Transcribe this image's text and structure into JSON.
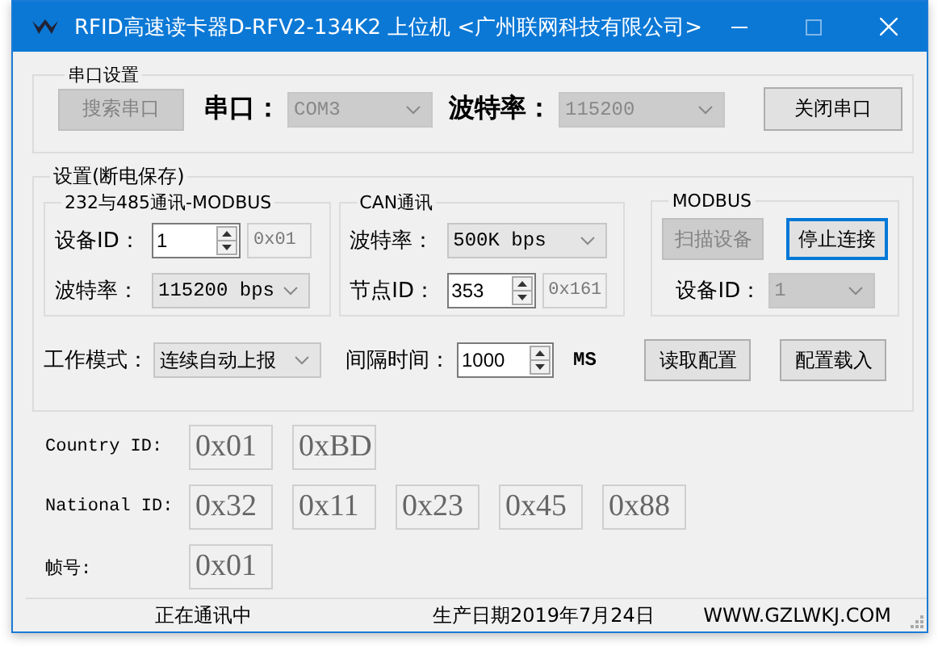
{
  "window": {
    "title": "RFID高速读卡器D-RFV2-134K2 上位机 <广州联网科技有限公司>"
  },
  "serial_settings": {
    "title": "串口设置",
    "search_button": {
      "label": "搜索串口",
      "disabled": true
    },
    "port_label": "串口：",
    "port": {
      "value": "COM3",
      "disabled": true
    },
    "baud_label": "波特率：",
    "baud": {
      "value": "115200",
      "disabled": true
    },
    "close_button": {
      "label": "关闭串口",
      "disabled": false
    }
  },
  "settings": {
    "title": "设置(断电保存)",
    "rs485": {
      "title": "232与485通讯-MODBUS",
      "device_id_label": "设备ID：",
      "device_id": "1",
      "device_id_hex": "0x01",
      "baud_label": "波特率：",
      "baud": "115200 bps"
    },
    "can": {
      "title": "CAN通讯",
      "baud_label": "波特率：",
      "baud": "500K bps",
      "node_id_label": "节点ID：",
      "node_id": "353",
      "node_id_hex": "0x161"
    },
    "modbus": {
      "title": "MODBUS",
      "scan_button": {
        "label": "扫描设备",
        "disabled": true
      },
      "stop_button": {
        "label": "停止连接",
        "disabled": false,
        "focused": true
      },
      "device_id_label": "设备ID：",
      "device_id": {
        "value": "1",
        "disabled": true
      }
    },
    "mode_label": "工作模式：",
    "mode": "连续自动上报",
    "interval_label": "间隔时间：",
    "interval": "1000",
    "interval_unit": "MS",
    "read_button": {
      "label": "读取配置",
      "disabled": false
    },
    "load_button": {
      "label": "配置载入",
      "disabled": false
    }
  },
  "ids": [
    {
      "label": "Country ID:",
      "values": [
        "0x01",
        "0xBD"
      ]
    },
    {
      "label": "National ID:",
      "values": [
        "0x32",
        "0x11",
        "0x23",
        "0x45",
        "0x88"
      ]
    },
    {
      "label": "帧号:",
      "values": [
        "0x01"
      ]
    }
  ],
  "status_bar": [
    "正在通讯中",
    "生产日期2019年7月24日",
    "WWW.GZLWKJ.COM"
  ]
}
